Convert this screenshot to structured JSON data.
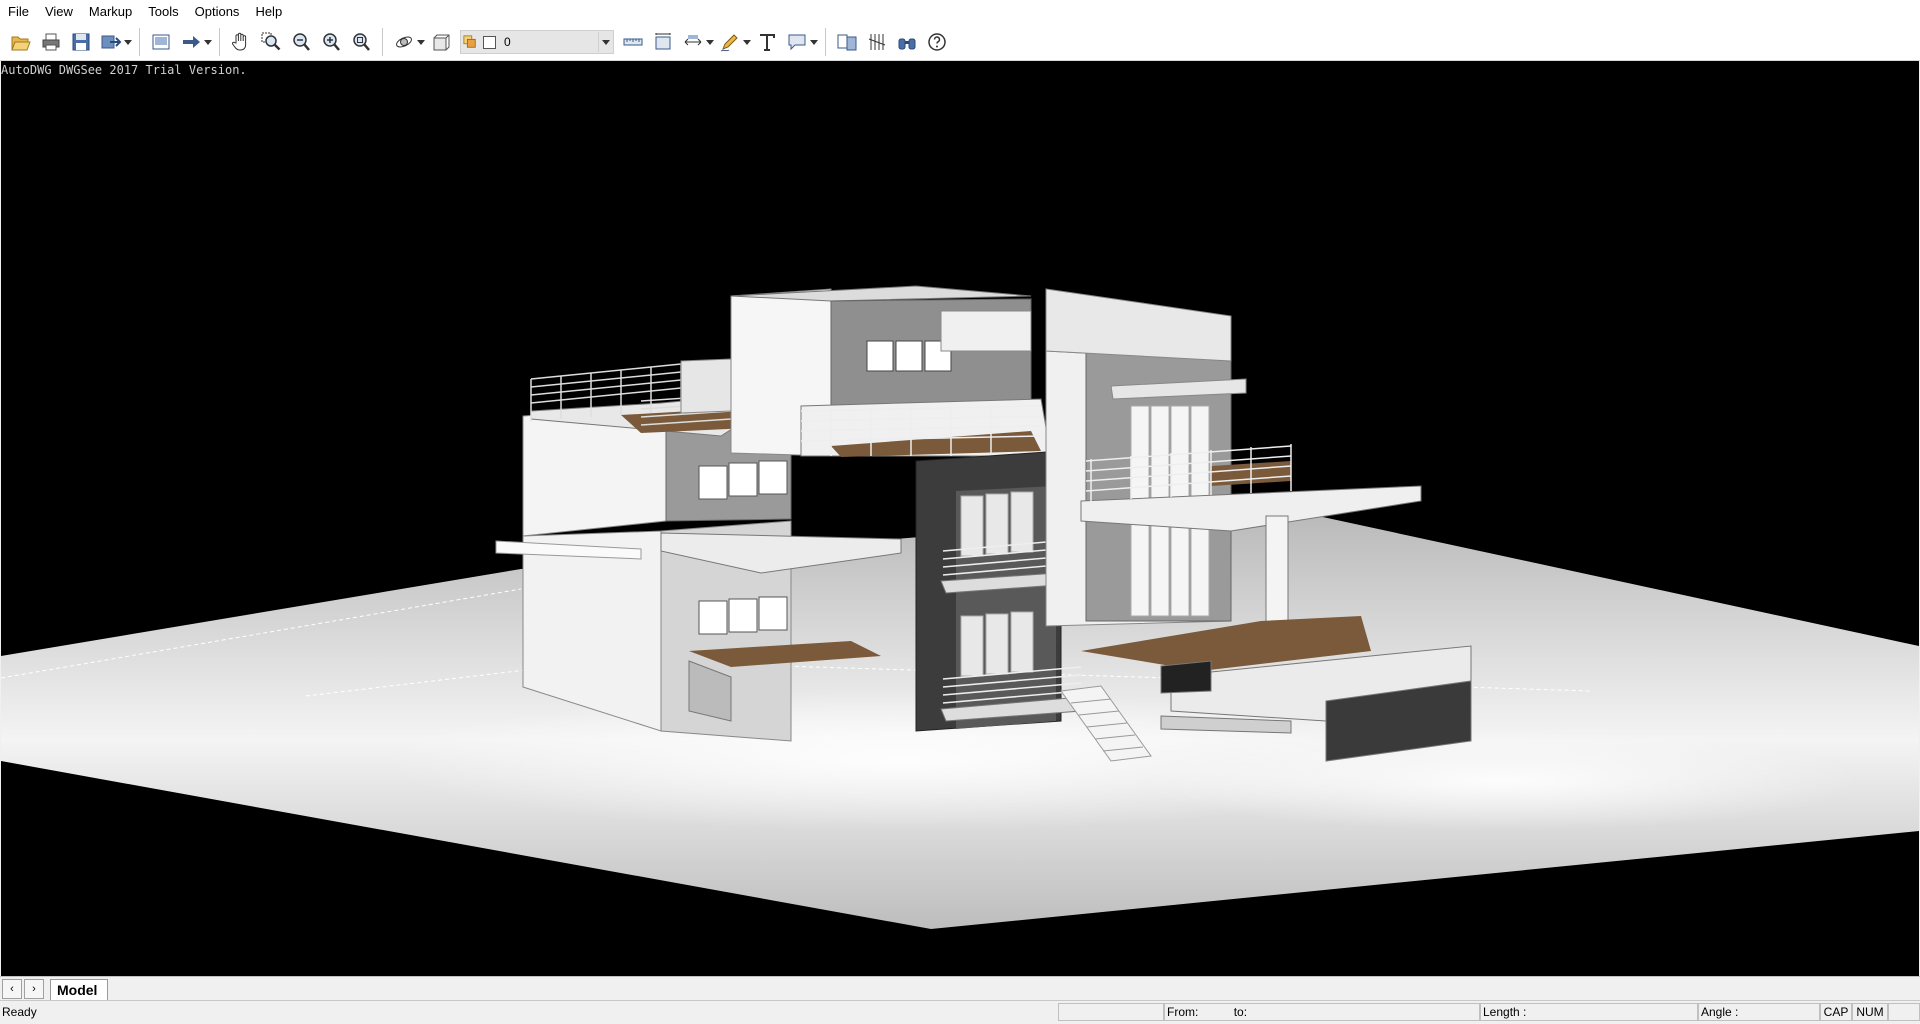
{
  "menu": [
    "File",
    "View",
    "Markup",
    "Tools",
    "Options",
    "Help"
  ],
  "toolbar": {
    "layer_value": "0",
    "tool_names": [
      "open",
      "print",
      "save",
      "export",
      "layout",
      "arrow",
      "pan",
      "zoom-window",
      "zoom-out",
      "zoom-in",
      "zoom-extents",
      "orbit",
      "3d-box",
      "measure-distance",
      "measure-area",
      "dimension",
      "freehand",
      "text",
      "callout",
      "compare",
      "hatch",
      "find",
      "help"
    ]
  },
  "viewport": {
    "watermark": "AutoDWG DWGSee 2017 Trial Version."
  },
  "tabs": {
    "prev": "‹",
    "next": "›",
    "model": "Model"
  },
  "status": {
    "ready": "Ready",
    "from": "From:",
    "to": "to:",
    "length": "Length :",
    "angle": "Angle :",
    "cap": "CAP",
    "num": "NUM"
  },
  "colors": {
    "viewport_bg": "#000000",
    "deck_wood": "#7a5a3a",
    "wall_light": "#f2f2f2",
    "wall_mid": "#9a9a9a",
    "wall_dark": "#3c3c3c"
  }
}
